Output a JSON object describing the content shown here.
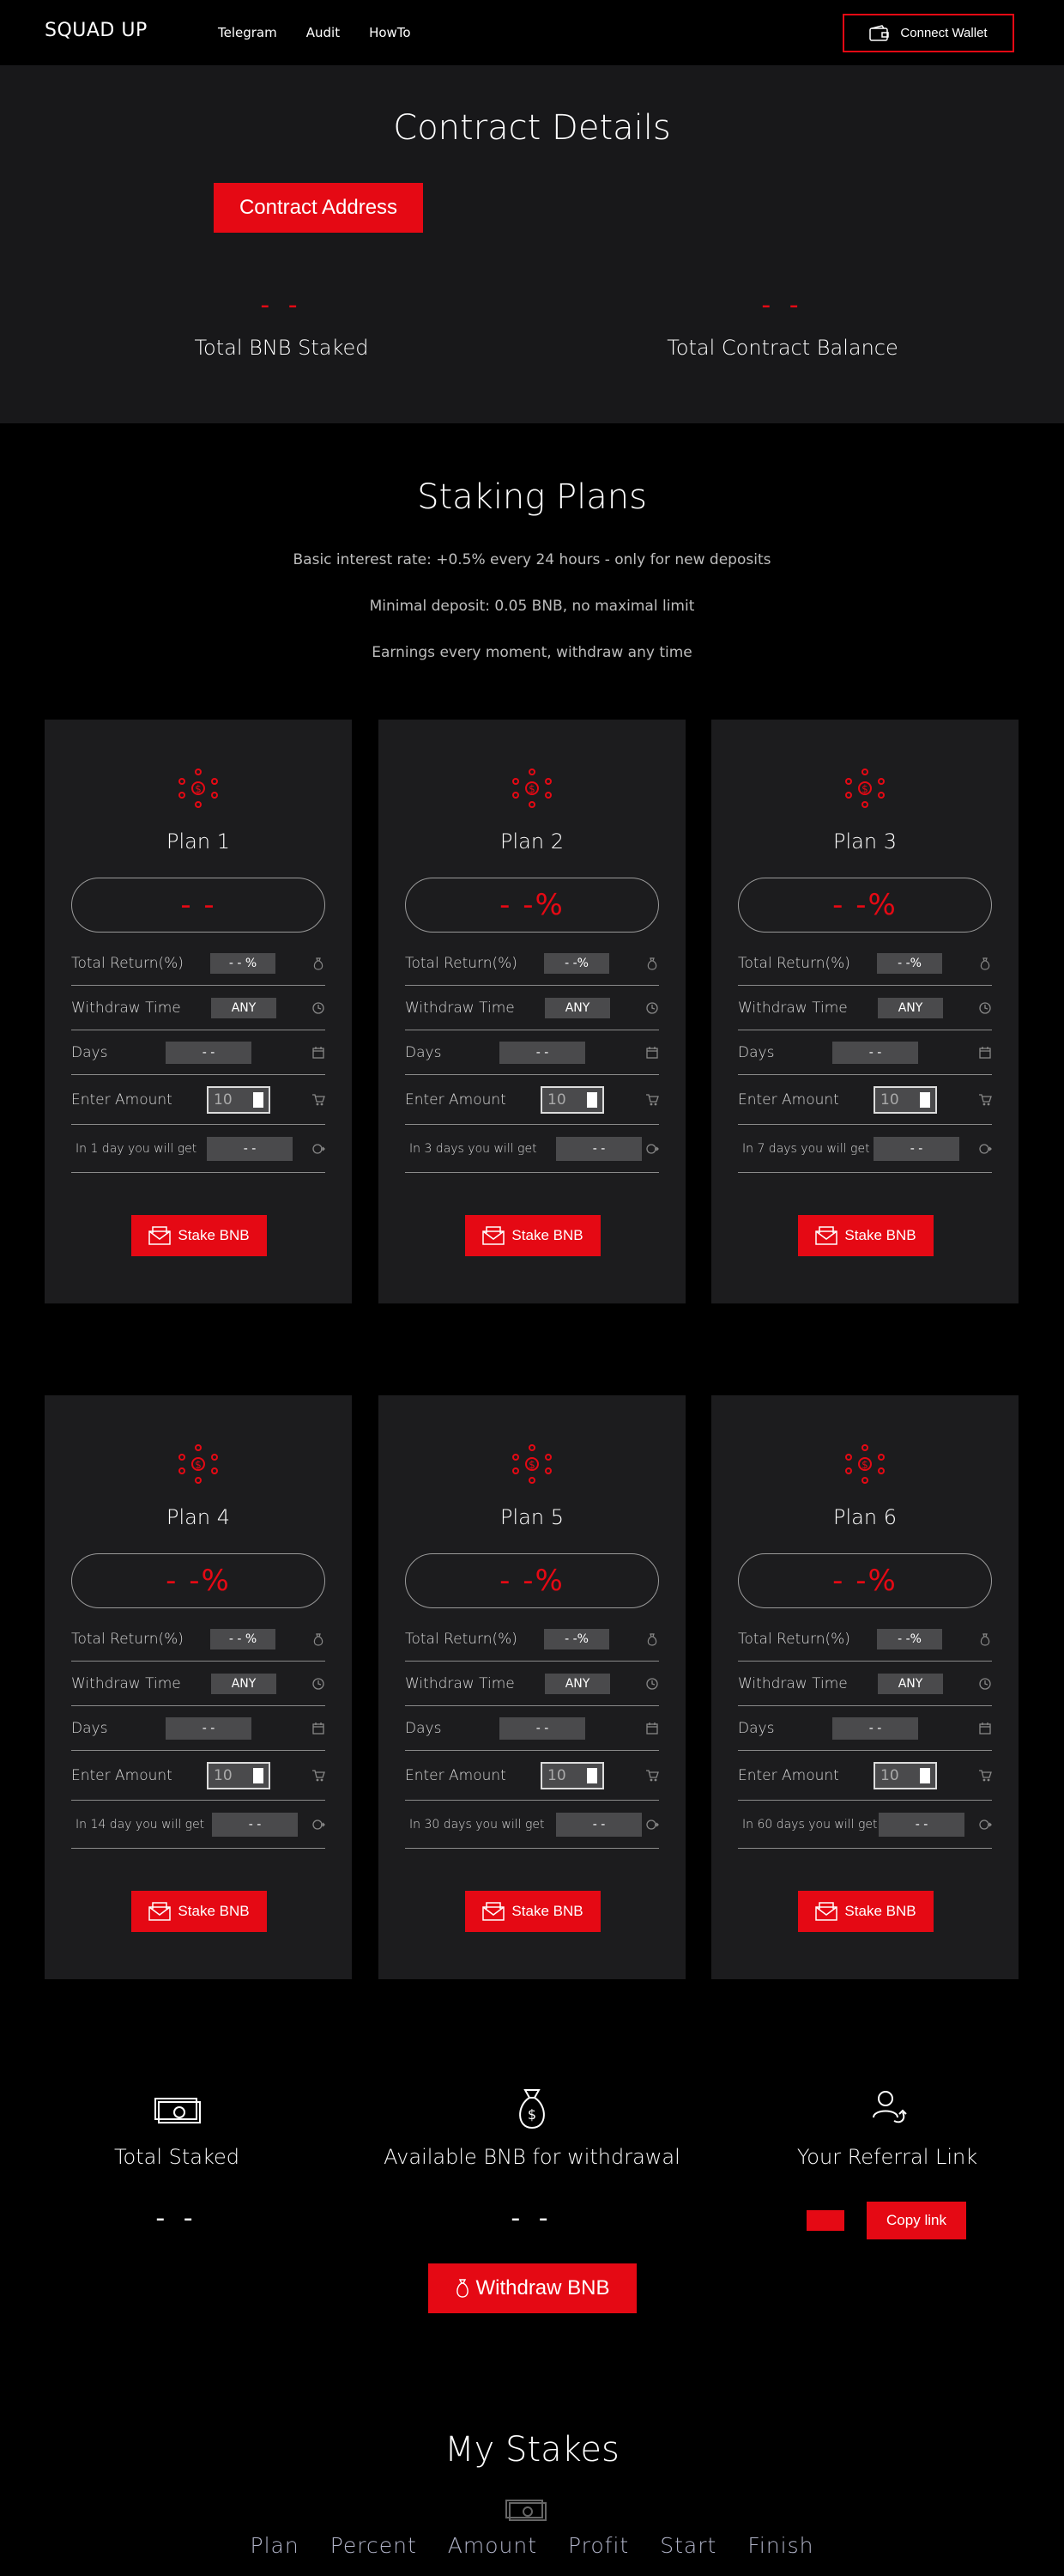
{
  "header": {
    "logo": "SQUAD UP",
    "nav": [
      "Telegram",
      "Audit",
      "HowTo"
    ],
    "connect_wallet": "Connect Wallet"
  },
  "contract": {
    "title": "Contract Details",
    "address_button": "Contract Address",
    "total_staked_value": "- -",
    "total_staked_label": "Total BNB Staked",
    "balance_value": "- -",
    "balance_label": "Total Contract Balance"
  },
  "plans_section": {
    "title": "Staking Plans",
    "info": [
      "Basic interest rate: +0.5% every 24 hours - only for new deposits",
      "Minimal deposit: 0.05 BNB, no maximal limit",
      "Earnings every moment, withdraw any time"
    ],
    "labels": {
      "total_return": "Total Return(%)",
      "withdraw_time": "Withdraw Time",
      "days": "Days",
      "enter_amount": "Enter Amount",
      "stake_button": "Stake BNB"
    }
  },
  "plans": [
    {
      "name": "Plan 1",
      "percent": "- -",
      "total_return": "- - %",
      "withdraw": "ANY",
      "days": "- -",
      "amount": "10",
      "you_get_label": "In 1 day you will get",
      "you_get_value": "- -"
    },
    {
      "name": "Plan 2",
      "percent": "- -%",
      "total_return": "- -%",
      "withdraw": "ANY",
      "days": "- -",
      "amount": "10",
      "you_get_label": "In 3 days you will get",
      "you_get_value": "- -"
    },
    {
      "name": "Plan 3",
      "percent": "- -%",
      "total_return": "- -%",
      "withdraw": "ANY",
      "days": "- -",
      "amount": "10",
      "you_get_label": "In 7 days you will get",
      "you_get_value": "- -"
    },
    {
      "name": "Plan 4",
      "percent": "- -%",
      "total_return": "- - %",
      "withdraw": "ANY",
      "days": "- -",
      "amount": "10",
      "you_get_label": "In 14 day you will get",
      "you_get_value": "- -"
    },
    {
      "name": "Plan 5",
      "percent": "- -%",
      "total_return": "- -%",
      "withdraw": "ANY",
      "days": "- -",
      "amount": "10",
      "you_get_label": "In 30 days you will get",
      "you_get_value": "- -"
    },
    {
      "name": "Plan 6",
      "percent": "- -%",
      "total_return": "- -%",
      "withdraw": "ANY",
      "days": "- -",
      "amount": "10",
      "you_get_label": "In 60 days you will get",
      "you_get_value": "- -"
    }
  ],
  "totals": {
    "total_staked_label": "Total Staked",
    "total_staked_value": "- -",
    "available_label": "Available BNB for withdrawal",
    "available_value": "- -",
    "referral_label": "Your Referral Link",
    "copy_link": "Copy link",
    "withdraw_button": "Withdraw BNB"
  },
  "my_stakes": {
    "title": "My Stakes",
    "columns": [
      "Plan",
      "Percent",
      "Amount",
      "Profit",
      "Start",
      "Finish"
    ]
  },
  "colors": {
    "accent": "#e50914",
    "card": "#1c1c1e",
    "section": "#18181a"
  }
}
